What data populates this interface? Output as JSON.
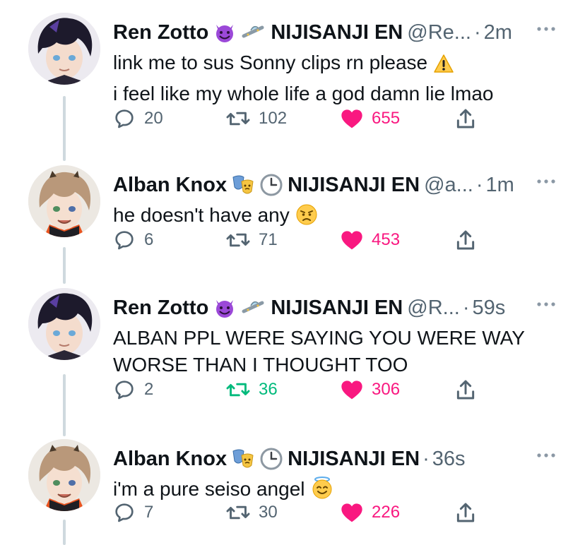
{
  "tweets": [
    {
      "name": "Ren Zotto",
      "badges": [
        "smiling-devil",
        "ufo"
      ],
      "org": "NIJISANJI EN",
      "handle": "@Re...",
      "time": "2m",
      "text_lines": [
        "link me to sus Sonny clips rn please",
        "i feel like my whole life a god damn lie lmao"
      ],
      "text_emoji": "warning",
      "replies": "20",
      "retweets": "102",
      "likes": "655",
      "retweeted": false,
      "liked": true
    },
    {
      "name": "Alban Knox",
      "badges": [
        "performing-arts",
        "clock"
      ],
      "org": "NIJISANJI EN",
      "handle": "@a...",
      "time": "1m",
      "text_lines": [
        "he doesn't have any"
      ],
      "text_emoji": "angry-face",
      "replies": "6",
      "retweets": "71",
      "likes": "453",
      "retweeted": false,
      "liked": true
    },
    {
      "name": "Ren Zotto",
      "badges": [
        "smiling-devil",
        "ufo"
      ],
      "org": "NIJISANJI EN",
      "handle": "@R...",
      "time": "59s",
      "text_lines": [
        "ALBAN PPL WERE SAYING YOU WERE WAY",
        "WORSE THAN I THOUGHT TOO"
      ],
      "text_emoji": "",
      "replies": "2",
      "retweets": "36",
      "likes": "306",
      "retweeted": true,
      "liked": true
    },
    {
      "name": "Alban Knox",
      "badges": [
        "performing-arts",
        "clock"
      ],
      "org": "NIJISANJI EN",
      "handle": "",
      "time": "36s",
      "text_lines": [
        "i'm a pure seiso angel"
      ],
      "text_emoji": "halo-smile",
      "replies": "7",
      "retweets": "30",
      "likes": "226",
      "retweeted": false,
      "liked": true
    }
  ],
  "separator": "·",
  "colors": {
    "text": "#0f1419",
    "muted": "#536471",
    "like": "#f91880",
    "retweet_active": "#00ba7c",
    "thread_line": "#cfd9de"
  }
}
